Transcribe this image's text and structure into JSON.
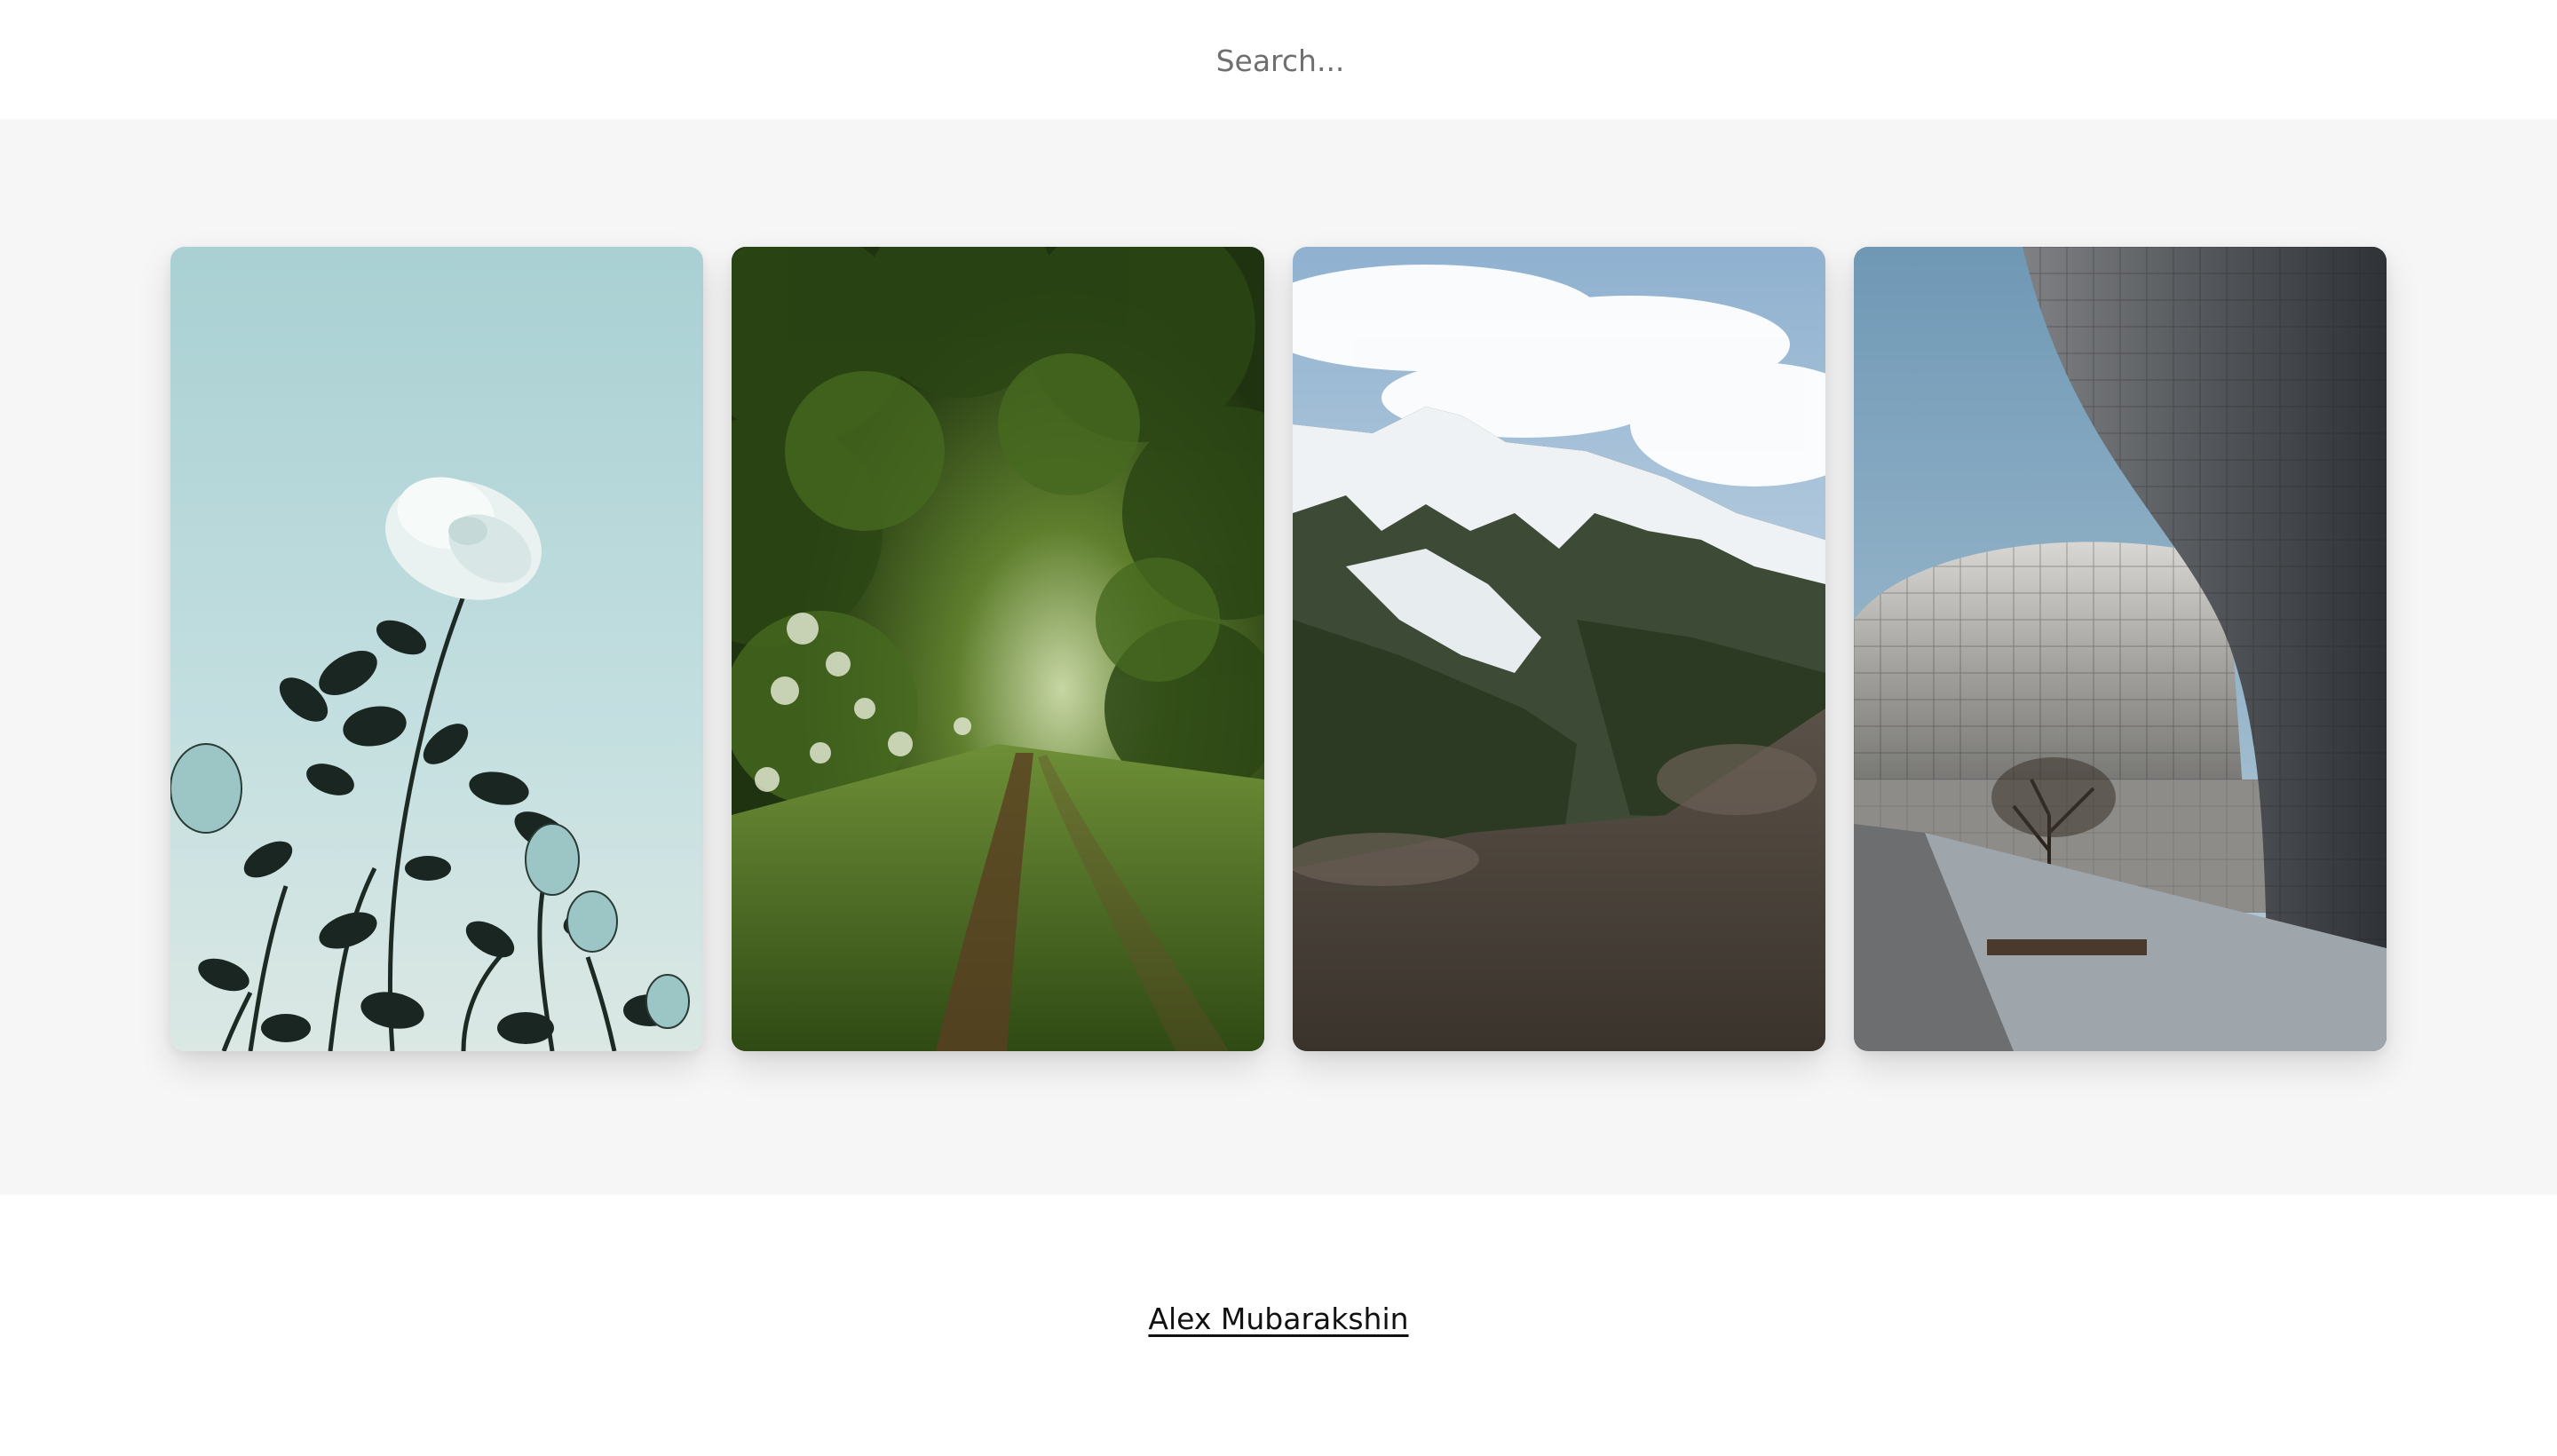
{
  "search": {
    "placeholder": "Search..."
  },
  "gallery": {
    "photos": [
      {
        "subject": "white rose against pale blue sky",
        "icon": "rose-photo"
      },
      {
        "subject": "green forest path under tree canopy",
        "icon": "forest-path-photo"
      },
      {
        "subject": "snowy mountain range with cloudy sky",
        "icon": "mountain-photo"
      },
      {
        "subject": "curved metallic tiled architecture",
        "icon": "architecture-photo"
      }
    ]
  },
  "footer": {
    "author": "Alex Mubarakshin"
  },
  "colors": {
    "band_background": "#f6f6f6",
    "page_background": "#ffffff",
    "link": "#111111"
  }
}
